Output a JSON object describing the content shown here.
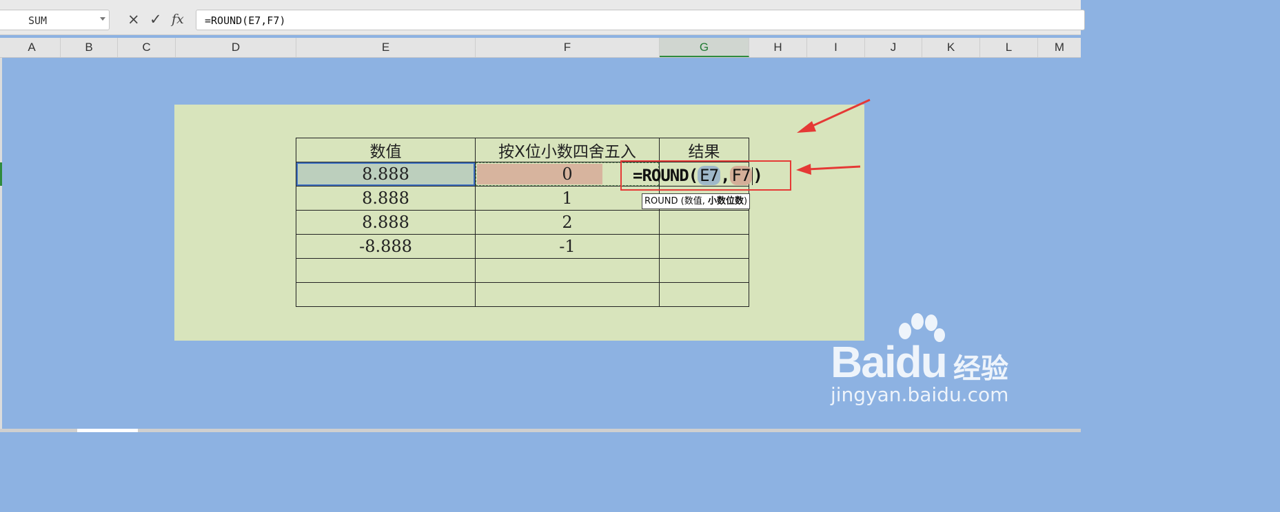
{
  "formula_bar": {
    "name_box": "SUM",
    "cancel_icon": "×",
    "confirm_icon": "✓",
    "fx_icon": "fx",
    "formula": "=ROUND(E7,F7)"
  },
  "columns": [
    "A",
    "B",
    "C",
    "D",
    "E",
    "F",
    "G",
    "H",
    "I",
    "J",
    "K",
    "L",
    "M"
  ],
  "active_column": "G",
  "table": {
    "headers": [
      "数值",
      "按X位小数四舍五入",
      "结果"
    ],
    "rows": [
      [
        "8.888",
        "0",
        ""
      ],
      [
        "8.888",
        "1",
        ""
      ],
      [
        "8.888",
        "2",
        ""
      ],
      [
        "-8.888",
        "-1",
        ""
      ],
      [
        "",
        "",
        ""
      ],
      [
        "",
        "",
        ""
      ]
    ]
  },
  "editor": {
    "prefix": "=ROUND(",
    "ref1": "E7",
    "sep": ",",
    "ref2": "F7",
    "suffix": ")"
  },
  "tooltip": {
    "func": "ROUND",
    "open": " (数值, ",
    "current_arg": "小数位数",
    "close": ")"
  },
  "colors": {
    "background": "#8db2e2",
    "panel": "#d8e4bc",
    "annotation": "#e53935",
    "ref_e": "#9fb8c9",
    "ref_f": "#d4ae98"
  },
  "watermark": {
    "brand": "Bai",
    "brand2": "du",
    "cn": "经验",
    "url": "jingyan.baidu.com"
  }
}
